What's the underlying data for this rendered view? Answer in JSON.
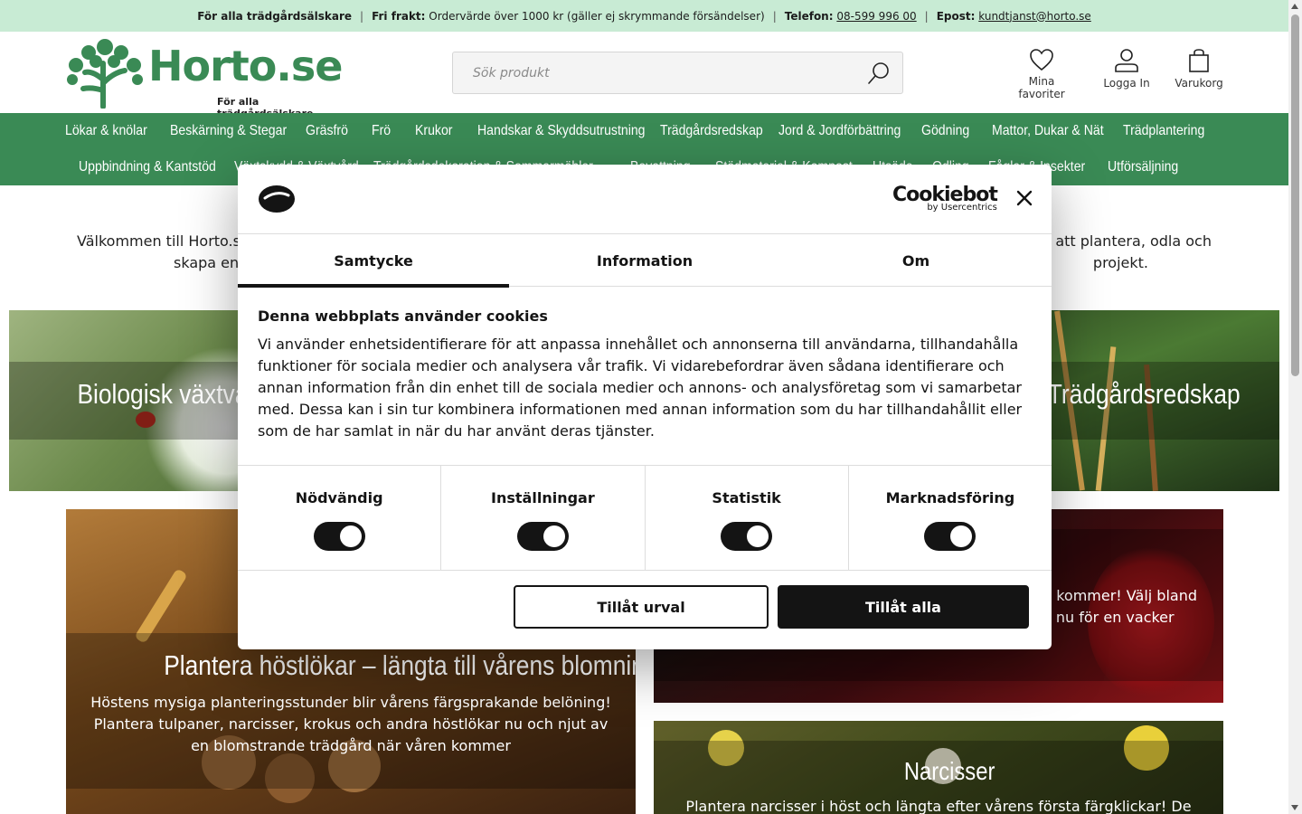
{
  "topbar": {
    "tagline": "För alla trädgårdsälskare",
    "freight_label": "Fri frakt:",
    "freight_text": "Ordervärde över 1000 kr (gäller ej skrymmande försändelser)",
    "phone_label": "Telefon:",
    "phone": "08-599 996 00",
    "email_label": "Epost:",
    "email": "kundtjanst@horto.se",
    "separator": "|"
  },
  "header": {
    "logo_name": "Horto.se",
    "logo_tagline": "För alla trädgårdsälskare",
    "search_placeholder": "Sök produkt",
    "favorites": "Mina favoriter",
    "login": "Logga In",
    "cart": "Varukorg"
  },
  "nav": {
    "row1": [
      "Lökar & knölar",
      "Beskärning & Stegar",
      "Gräsfrö",
      "Frö",
      "Krukor",
      "Handskar & Skyddsutrustning",
      "Trädgårdsredskap",
      "Jord & Jordförbättring",
      "Gödning",
      "Mattor, Dukar & Nät",
      "Trädplantering"
    ],
    "row2": [
      "Uppbindning & Kantstöd",
      "Växtskydd & Växtvård",
      "Trädgårdsdekoration & Sommarmöbler",
      "Bevattning",
      "Stödmaterial & Kompost",
      "Utsäde",
      "Odling",
      "Fåglar & Insekter",
      "Utförsäljning"
    ]
  },
  "intro": {
    "line1_left": "Välkommen till Horto.s",
    "line1_right": "att plantera, odla och",
    "line2_left": "skapa en",
    "line2_right": "projekt."
  },
  "banners": {
    "bio_title": "Biologisk växtvår",
    "tools_title": "Trädgårdsredskap",
    "autumn_title": "Plantera höstlökar – längta till vårens blomning",
    "autumn_text": "Höstens mysiga planteringsstunder blir vårens färgsprakande belöning! Plantera tulpaner, narcisser, krokus och andra höstlökar nu och njut av en blomstrande trädgård när våren kommer",
    "tulip_text_1": "n kommer! Välj bland",
    "tulip_text_2": "a nu för en vacker",
    "narcissus_title": "Narcisser",
    "narcissus_text": "Plantera narcisser i höst och längta efter vårens första färgklickar! De"
  },
  "cookie": {
    "brand": "Cookiebot",
    "brand_sub": "by Usercentrics",
    "tabs": [
      "Samtycke",
      "Information",
      "Om"
    ],
    "heading": "Denna webbplats använder cookies",
    "body": "Vi använder enhetsidentifierare för att anpassa innehållet och annonserna till användarna, tillhandahålla funktioner för sociala medier och analysera vår trafik. Vi vidarebefordrar även sådana identifierare och annan information från din enhet till de sociala medier och annons- och analysföretag som vi samarbetar med. Dessa kan i sin tur kombinera informationen med annan information som du har tillhandahållit eller som de har samlat in när du har använt deras tjänster.",
    "categories": [
      "Nödvändig",
      "Inställningar",
      "Statistik",
      "Marknadsföring"
    ],
    "btn_selection": "Tillåt urval",
    "btn_all": "Tillåt alla"
  }
}
